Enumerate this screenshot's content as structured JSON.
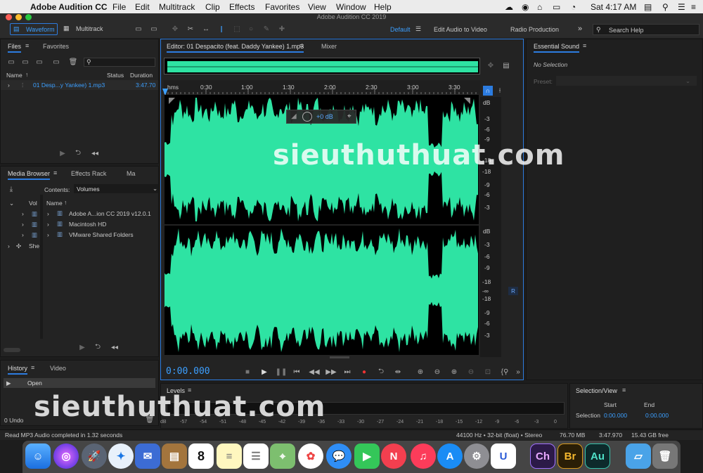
{
  "menubar": {
    "app": "Adobe Audition CC",
    "items": [
      "File",
      "Edit",
      "Multitrack",
      "Clip",
      "Effects",
      "Favorites",
      "View",
      "Window",
      "Help"
    ],
    "clock": "Sat 4:17 AM"
  },
  "window": {
    "title": "Adobe Audition CC 2019"
  },
  "toolbar": {
    "waveform": "Waveform",
    "multitrack": "Multitrack",
    "workspaces": [
      "Default",
      "Edit Audio to Video",
      "Radio Production"
    ],
    "search": "Search Help"
  },
  "files": {
    "tabs": [
      "Files",
      "Favorites"
    ],
    "columns": [
      "Name",
      "Status",
      "Duration"
    ],
    "item_name": "01 Desp...y Yankee) 1.mp3",
    "item_duration": "3:47.70"
  },
  "media": {
    "tabs": [
      "Media Browser",
      "Effects Rack",
      "Ma"
    ],
    "contents_label": "Contents:",
    "contents_value": "Volumes",
    "column": "Name",
    "left_items": [
      "Vol",
      "She"
    ],
    "items": [
      "Adobe A...ion CC 2019 v12.0.1",
      "Macintosh HD",
      "VMware Shared Folders"
    ]
  },
  "history": {
    "tabs": [
      "History",
      "Video"
    ],
    "item": "Open",
    "undo": "0 Undo"
  },
  "editor": {
    "tab": "Editor: 01 Despacito (feat. Daddy Yankee) 1.mp3",
    "mixer": "Mixer",
    "time": "0:00.000",
    "hud_value": "+0 dB",
    "ruler": [
      "hms",
      "0:30",
      "1:00",
      "1:30",
      "2:00",
      "2:30",
      "3:00",
      "3:30"
    ],
    "db_scale": [
      "dB",
      "-3",
      "-6",
      "-9",
      "-18",
      "-18",
      "-9",
      "-6",
      "-3"
    ],
    "db_scale2": [
      "dB",
      "-3",
      "-6",
      "-9",
      "-18",
      "-∞",
      "-18",
      "-9",
      "-6",
      "-3"
    ],
    "channel_r": "R"
  },
  "essential": {
    "title": "Essential Sound",
    "status": "No Selection",
    "preset_label": "Preset:"
  },
  "levels": {
    "title": "Levels",
    "scale": [
      "dB",
      "-57",
      "-54",
      "-51",
      "-48",
      "-45",
      "-42",
      "-39",
      "-36",
      "-33",
      "-30",
      "-27",
      "-24",
      "-21",
      "-18",
      "-15",
      "-12",
      "-9",
      "-6",
      "-3",
      "0"
    ]
  },
  "selection": {
    "title": "Selection/View",
    "start_label": "Start",
    "end_label": "End",
    "row_label": "Selection",
    "start": "0:00.000",
    "end": "0:00.000"
  },
  "status": {
    "message": "Read MP3 Audio completed in 1.32 seconds",
    "format": "44100 Hz • 32-bit (float) • Stereo",
    "size": "76.70 MB",
    "duration": "3:47.970",
    "free": "15.43 GB free"
  },
  "watermark": "sieuthuthuat.com",
  "dock": {
    "apps": [
      "Ch",
      "Br",
      "Au"
    ]
  },
  "colors": {
    "waveform": "#2ee3a3",
    "accent": "#2c7ce0",
    "timecode": "#3c9fff"
  }
}
